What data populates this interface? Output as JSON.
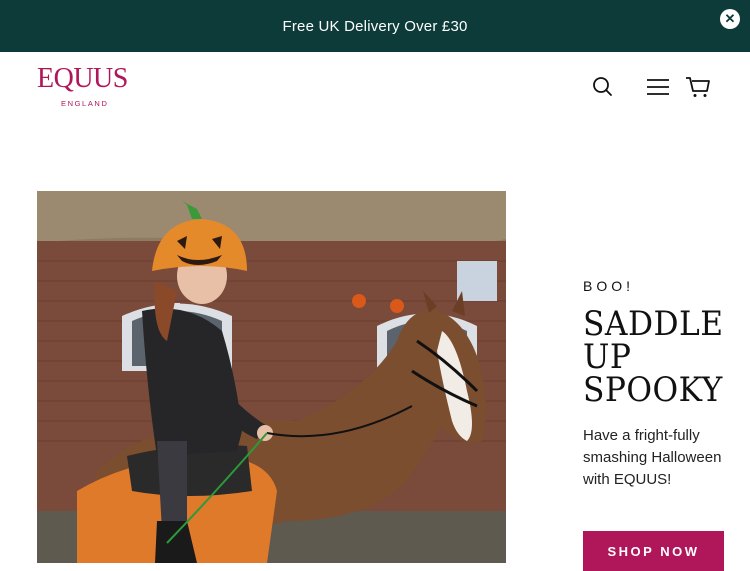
{
  "announcement": {
    "text": "Free UK Delivery Over £30",
    "close_icon": "close-icon"
  },
  "header": {
    "logo_main": "EQUUS",
    "logo_sub": "ENGLAND",
    "icons": [
      "search-icon",
      "menu-icon",
      "cart-icon"
    ]
  },
  "hero": {
    "eyebrow": "BOO!",
    "headline": [
      "SADDLE",
      "UP",
      "SPOOKY"
    ],
    "subtext": "Have a fright-fully smashing Halloween with EQUUS!",
    "cta_label": "SHOP NOW",
    "image_alt": "Child in pumpkin helmet cover riding a brown pony with orange saddle pad in front of a brick building"
  },
  "colors": {
    "announcement_bg": "#0d3b3a",
    "brand": "#b0175a",
    "text": "#111111"
  }
}
